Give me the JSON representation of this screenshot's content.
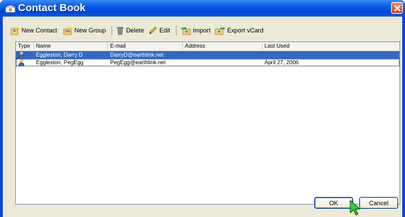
{
  "window": {
    "title": "Contact Book"
  },
  "toolbar": {
    "new_contact": "New Contact",
    "new_group": "New Group",
    "delete": "Delete",
    "edit": "Edit",
    "import": "Import",
    "export": "Export vCard"
  },
  "columns": {
    "type": "Type",
    "name": "Name",
    "email": "E-mail",
    "address": "Address",
    "last_used": "Last Used"
  },
  "rows": [
    {
      "name": "Eggleston, Darry D",
      "email": "DarryD@earthlink.net",
      "address": "",
      "last_used": "",
      "selected": true
    },
    {
      "name": "Eggleston, PegEgg",
      "email": "PegEgg@earthlink.net",
      "address": "",
      "last_used": "April 27, 2006",
      "selected": false
    }
  ],
  "buttons": {
    "ok": "OK",
    "cancel": "Cancel"
  },
  "colors": {
    "title_bar": "#0a55e0",
    "selection": "#316ac5",
    "dialog_bg": "#ece9d8"
  }
}
